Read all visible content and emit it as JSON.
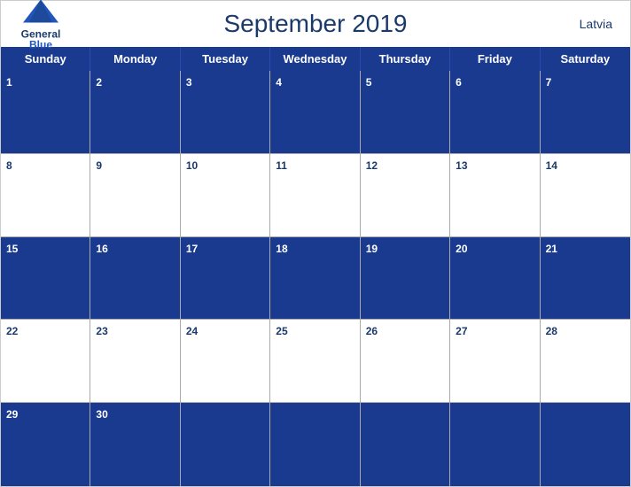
{
  "header": {
    "title": "September 2019",
    "country": "Latvia",
    "logo": {
      "general": "General",
      "blue": "Blue"
    }
  },
  "days": [
    "Sunday",
    "Monday",
    "Tuesday",
    "Wednesday",
    "Thursday",
    "Friday",
    "Saturday"
  ],
  "weeks": [
    {
      "style": "blue",
      "cells": [
        {
          "number": "1",
          "empty": false
        },
        {
          "number": "2",
          "empty": false
        },
        {
          "number": "3",
          "empty": false
        },
        {
          "number": "4",
          "empty": false
        },
        {
          "number": "5",
          "empty": false
        },
        {
          "number": "6",
          "empty": false
        },
        {
          "number": "7",
          "empty": false
        }
      ]
    },
    {
      "style": "white",
      "cells": [
        {
          "number": "8",
          "empty": false
        },
        {
          "number": "9",
          "empty": false
        },
        {
          "number": "10",
          "empty": false
        },
        {
          "number": "11",
          "empty": false
        },
        {
          "number": "12",
          "empty": false
        },
        {
          "number": "13",
          "empty": false
        },
        {
          "number": "14",
          "empty": false
        }
      ]
    },
    {
      "style": "blue",
      "cells": [
        {
          "number": "15",
          "empty": false
        },
        {
          "number": "16",
          "empty": false
        },
        {
          "number": "17",
          "empty": false
        },
        {
          "number": "18",
          "empty": false
        },
        {
          "number": "19",
          "empty": false
        },
        {
          "number": "20",
          "empty": false
        },
        {
          "number": "21",
          "empty": false
        }
      ]
    },
    {
      "style": "white",
      "cells": [
        {
          "number": "22",
          "empty": false
        },
        {
          "number": "23",
          "empty": false
        },
        {
          "number": "24",
          "empty": false
        },
        {
          "number": "25",
          "empty": false
        },
        {
          "number": "26",
          "empty": false
        },
        {
          "number": "27",
          "empty": false
        },
        {
          "number": "28",
          "empty": false
        }
      ]
    },
    {
      "style": "blue",
      "cells": [
        {
          "number": "29",
          "empty": false
        },
        {
          "number": "30",
          "empty": false
        },
        {
          "number": "",
          "empty": true
        },
        {
          "number": "",
          "empty": true
        },
        {
          "number": "",
          "empty": true
        },
        {
          "number": "",
          "empty": true
        },
        {
          "number": "",
          "empty": true
        }
      ]
    }
  ]
}
